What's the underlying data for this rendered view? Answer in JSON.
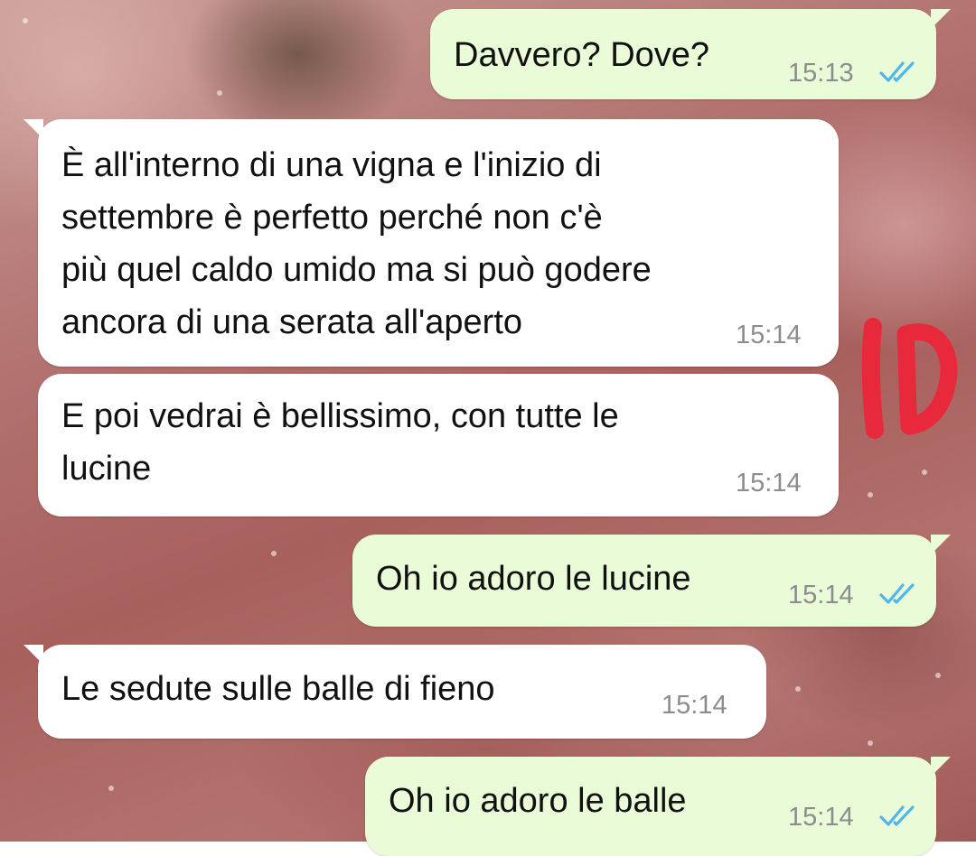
{
  "chat": {
    "messages": [
      {
        "direction": "outgoing",
        "text": "Davvero? Dove?",
        "time": "15:13",
        "status": "read",
        "status_icon": "double-check-icon"
      },
      {
        "direction": "incoming",
        "text": "È all'interno di una vigna e l'inizio di\nsettembre è perfetto perché non c'è\npiù quel caldo umido ma si può godere\nancora di una serata all'aperto",
        "time": "15:14"
      },
      {
        "direction": "incoming",
        "text": "E poi vedrai è bellissimo, con tutte le\nlucine",
        "time": "15:14"
      },
      {
        "direction": "outgoing",
        "text": "Oh io adoro le lucine",
        "time": "15:14",
        "status": "read",
        "status_icon": "double-check-icon"
      },
      {
        "direction": "incoming",
        "text": "Le sedute sulle balle di fieno",
        "time": "15:14"
      },
      {
        "direction": "outgoing",
        "text": "Oh io adoro le balle",
        "time": "15:14",
        "status": "read",
        "status_icon": "double-check-icon"
      }
    ]
  },
  "annotation": {
    "handwritten_text": "10",
    "color": "#e8293c"
  },
  "colors": {
    "incoming_bubble": "#ffffff",
    "outgoing_bubble": "#e9fbd7",
    "read_ticks": "#4fb6ec",
    "timestamp": "#8c8c8c"
  }
}
